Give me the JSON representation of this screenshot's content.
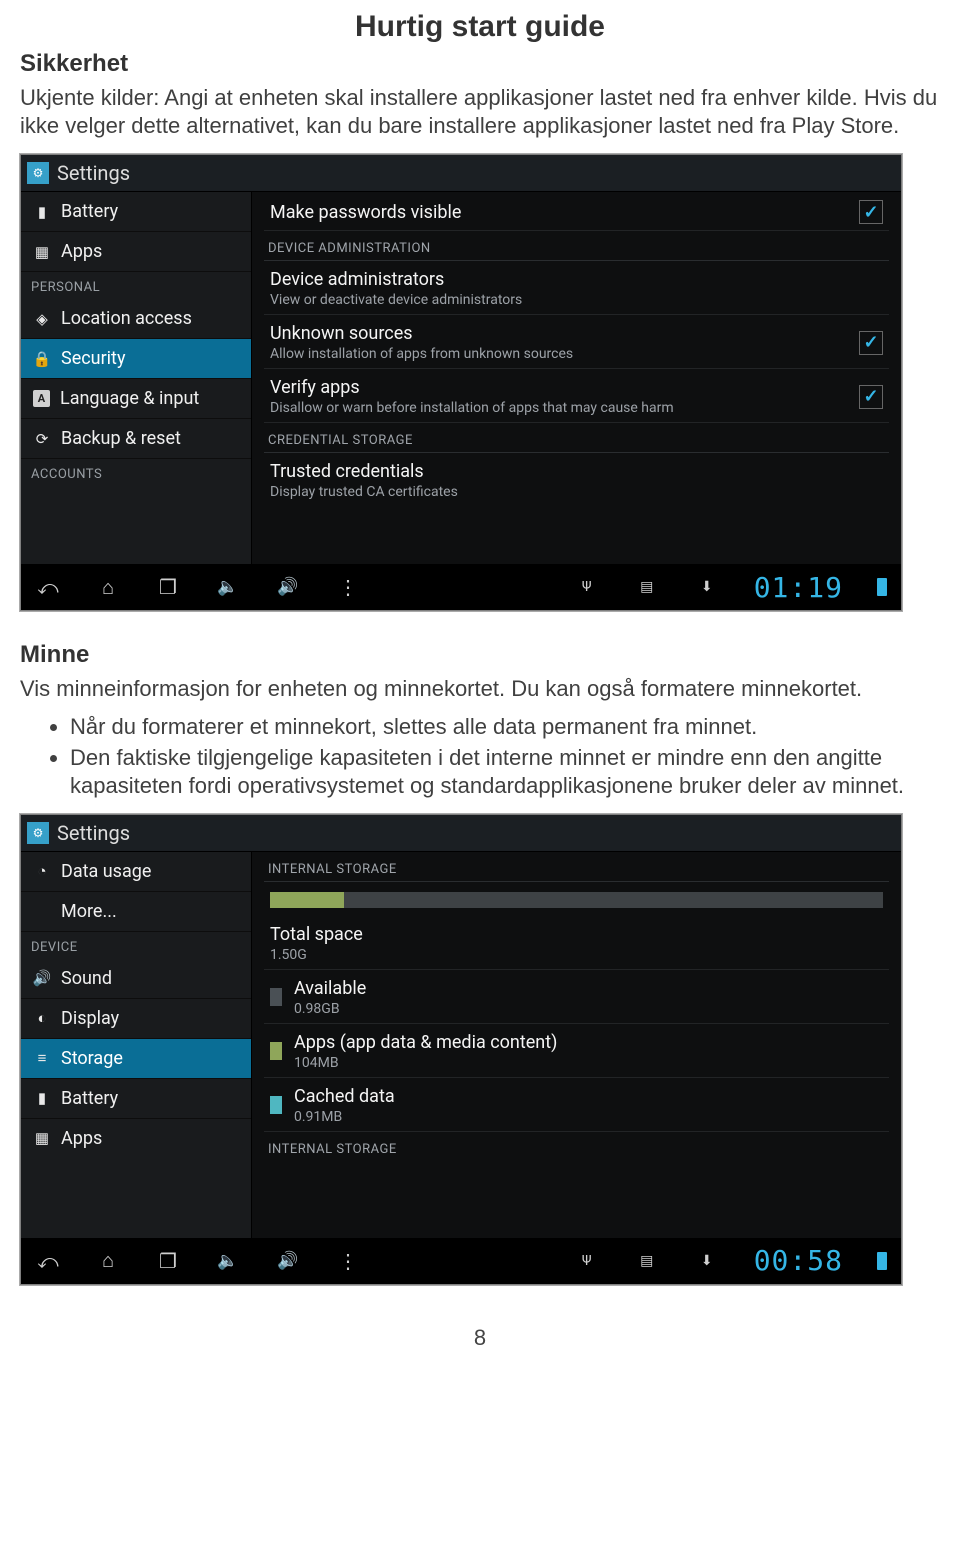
{
  "doc": {
    "title": "Hurtig start guide",
    "section1_h": "Sikkerhet",
    "section1_p": "Ukjente kilder: Angi at enheten skal installere applikasjoner lastet ned fra enhver kilde. Hvis du ikke velger dette alternativet, kan du bare installere applikasjoner lastet ned fra Play Store.",
    "section2_h": "Minne",
    "section2_p": "Vis minneinformasjon for enheten og minnekortet. Du kan også formatere minnekortet.",
    "bullets": {
      "b1": "Når du formaterer et minnekort, slettes alle data permanent fra minnet.",
      "b2": "Den faktiske tilgjengelige kapasiteten i det interne minnet er mindre enn den angitte kapasiteten fordi operativsystemet og standardapplikasjonene bruker deler av minnet."
    },
    "page_num": "8"
  },
  "shot1": {
    "title": "Settings",
    "clock": "01:19",
    "left": {
      "section_personal": "PERSONAL",
      "section_accounts": "ACCOUNTS",
      "items": {
        "battery": "Battery",
        "apps": "Apps",
        "location": "Location access",
        "security": "Security",
        "lang": "Language & input",
        "backup": "Backup & reset"
      }
    },
    "right": {
      "passwords_title": "Make passwords visible",
      "sec_admin": "DEVICE ADMINISTRATION",
      "dev_admin_t": "Device administrators",
      "dev_admin_s": "View or deactivate device administrators",
      "unknown_t": "Unknown sources",
      "unknown_s": "Allow installation of apps from unknown sources",
      "verify_t": "Verify apps",
      "verify_s": "Disallow or warn before installation of apps that may cause harm",
      "sec_cred": "CREDENTIAL STORAGE",
      "trusted_t": "Trusted credentials",
      "trusted_s": "Display trusted CA certificates"
    }
  },
  "shot2": {
    "title": "Settings",
    "clock": "00:58",
    "left": {
      "section_device": "DEVICE",
      "items": {
        "data": "Data usage",
        "more": "More...",
        "sound": "Sound",
        "display": "Display",
        "storage": "Storage",
        "battery": "Battery",
        "apps": "Apps"
      }
    },
    "right": {
      "sec_internal": "INTERNAL STORAGE",
      "total_t": "Total space",
      "total_v": "1.50G",
      "avail_t": "Available",
      "avail_v": "0.98GB",
      "apps_t": "Apps (app data & media content)",
      "apps_v": "104MB",
      "cache_t": "Cached data",
      "cache_v": "0.91MB",
      "sec_internal2": "INTERNAL STORAGE"
    },
    "colors": {
      "bar_seg1": "#8fa65a",
      "bar_seg2": "#3e4245",
      "swatch_avail": "#4a5055",
      "swatch_apps": "#8fa65a",
      "swatch_cache": "#4fb7c1"
    }
  },
  "chart_data": {
    "type": "bar",
    "title": "Internal storage",
    "categories": [
      "Total space",
      "Available",
      "Apps (app data & media content)",
      "Cached data"
    ],
    "values_raw": [
      "1.50G",
      "0.98GB",
      "104MB",
      "0.91MB"
    ],
    "values_gb": [
      1.5,
      0.98,
      0.104,
      0.00091
    ]
  }
}
